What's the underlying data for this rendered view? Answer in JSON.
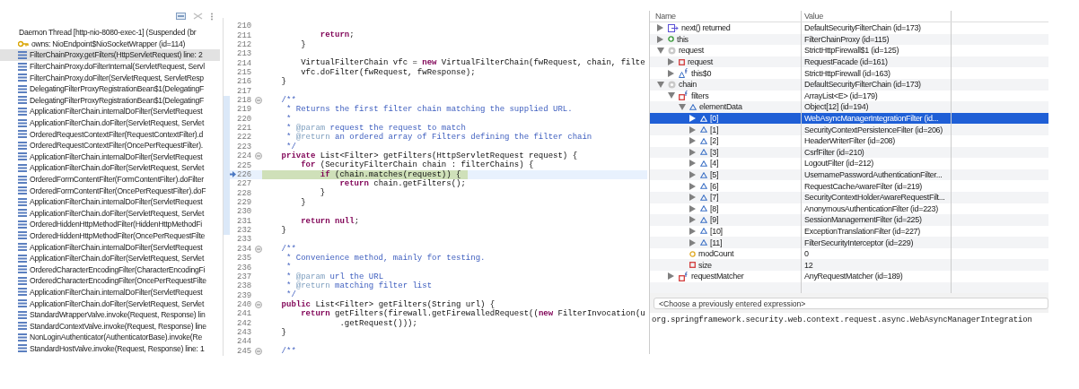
{
  "debug": {
    "thread": "Daemon Thread [http-nio-8080-exec-1] (Suspended (br",
    "monitor": "owns: NioEndpoint$NioSocketWrapper  (id=114)",
    "frames": [
      {
        "label": "FilterChainProxy.getFilters(HttpServletRequest) line: 2",
        "selected": true
      },
      {
        "label": "FilterChainProxy.doFilterInternal(ServletRequest, Servl",
        "selected": false
      },
      {
        "label": "FilterChainProxy.doFilter(ServletRequest, ServletResp",
        "selected": false
      },
      {
        "label": "DelegatingFilterProxyRegistrationBean$1(DelegatingF",
        "selected": false
      },
      {
        "label": "DelegatingFilterProxyRegistrationBean$1(DelegatingF",
        "selected": false
      },
      {
        "label": "ApplicationFilterChain.internalDoFilter(ServletRequest",
        "selected": false
      },
      {
        "label": "ApplicationFilterChain.doFilter(ServletRequest, Servlet",
        "selected": false
      },
      {
        "label": "OrderedRequestContextFilter(RequestContextFilter).d",
        "selected": false
      },
      {
        "label": "OrderedRequestContextFilter(OncePerRequestFilter).",
        "selected": false
      },
      {
        "label": "ApplicationFilterChain.internalDoFilter(ServletRequest",
        "selected": false
      },
      {
        "label": "ApplicationFilterChain.doFilter(ServletRequest, Servlet",
        "selected": false
      },
      {
        "label": "OrderedFormContentFilter(FormContentFilter).doFilter",
        "selected": false
      },
      {
        "label": "OrderedFormContentFilter(OncePerRequestFilter).doF",
        "selected": false
      },
      {
        "label": "ApplicationFilterChain.internalDoFilter(ServletRequest",
        "selected": false
      },
      {
        "label": "ApplicationFilterChain.doFilter(ServletRequest, Servlet",
        "selected": false
      },
      {
        "label": "OrderedHiddenHttpMethodFilter(HiddenHttpMethodFi",
        "selected": false
      },
      {
        "label": "OrderedHiddenHttpMethodFilter(OncePerRequestFilte",
        "selected": false
      },
      {
        "label": "ApplicationFilterChain.internalDoFilter(ServletRequest",
        "selected": false
      },
      {
        "label": "ApplicationFilterChain.doFilter(ServletRequest, Servlet",
        "selected": false
      },
      {
        "label": "OrderedCharacterEncodingFilter(CharacterEncodingFi",
        "selected": false
      },
      {
        "label": "OrderedCharacterEncodingFilter(OncePerRequestFilte",
        "selected": false
      },
      {
        "label": "ApplicationFilterChain.internalDoFilter(ServletRequest",
        "selected": false
      },
      {
        "label": "ApplicationFilterChain.doFilter(ServletRequest, Servlet",
        "selected": false
      },
      {
        "label": "StandardWrapperValve.invoke(Request, Response) lin",
        "selected": false
      },
      {
        "label": "StandardContextValve.invoke(Request, Response) line",
        "selected": false
      },
      {
        "label": "NonLoginAuthenticator(AuthenticatorBase).invoke(Re",
        "selected": false
      },
      {
        "label": "StandardHostValve.invoke(Request, Response) line: 1",
        "selected": false
      }
    ]
  },
  "editor": {
    "lines": [
      {
        "number": "210",
        "fold": false,
        "current": false,
        "marked": false
      },
      {
        "number": "211",
        "fold": false,
        "current": false,
        "marked": false,
        "segments": [
          {
            "kind": "keyword",
            "text": "            return"
          },
          {
            "kind": "code",
            "text": ";"
          }
        ]
      },
      {
        "number": "212",
        "fold": false,
        "current": false,
        "marked": false,
        "segments": [
          {
            "kind": "code",
            "text": "        }"
          }
        ]
      },
      {
        "number": "213",
        "fold": false,
        "current": false,
        "marked": false
      },
      {
        "number": "214",
        "fold": false,
        "current": false,
        "marked": false,
        "segments": [
          {
            "kind": "code",
            "text": "        VirtualFilterChain vfc = "
          },
          {
            "kind": "keyword",
            "text": "new"
          },
          {
            "kind": "code",
            "text": " VirtualFilterChain(fwRequest, chain, filte"
          }
        ]
      },
      {
        "number": "215",
        "fold": false,
        "current": false,
        "marked": false,
        "segments": [
          {
            "kind": "code",
            "text": "        vfc.doFilter(fwRequest, fwResponse);"
          }
        ]
      },
      {
        "number": "216",
        "fold": false,
        "current": false,
        "marked": false,
        "segments": [
          {
            "kind": "code",
            "text": "    }"
          }
        ]
      },
      {
        "number": "217",
        "fold": false,
        "current": false,
        "marked": false
      },
      {
        "number": "218",
        "fold": true,
        "current": false,
        "marked": true,
        "segments": [
          {
            "kind": "comment",
            "text": "    /**"
          }
        ]
      },
      {
        "number": "219",
        "fold": false,
        "current": false,
        "marked": true,
        "segments": [
          {
            "kind": "comment",
            "text": "     * Returns the first filter chain matching the supplied URL."
          }
        ]
      },
      {
        "number": "220",
        "fold": false,
        "current": false,
        "marked": true,
        "segments": [
          {
            "kind": "comment",
            "text": "     *"
          }
        ]
      },
      {
        "number": "221",
        "fold": false,
        "current": false,
        "marked": true,
        "segments": [
          {
            "kind": "comment",
            "text": "     * "
          },
          {
            "kind": "tag",
            "text": "@param"
          },
          {
            "kind": "comment",
            "text": " request the request to match"
          }
        ]
      },
      {
        "number": "222",
        "fold": false,
        "current": false,
        "marked": true,
        "segments": [
          {
            "kind": "comment",
            "text": "     * "
          },
          {
            "kind": "tag",
            "text": "@return"
          },
          {
            "kind": "comment",
            "text": " an ordered array of Filters defining the filter chain"
          }
        ]
      },
      {
        "number": "223",
        "fold": false,
        "current": false,
        "marked": true,
        "segments": [
          {
            "kind": "comment",
            "text": "     */"
          }
        ]
      },
      {
        "number": "224",
        "fold": true,
        "current": false,
        "marked": true,
        "segments": [
          {
            "kind": "keyword",
            "text": "    private"
          },
          {
            "kind": "code",
            "text": " List<Filter> getFilters(HttpServletRequest request) {"
          }
        ]
      },
      {
        "number": "225",
        "fold": false,
        "current": false,
        "marked": true,
        "segments": [
          {
            "kind": "keyword",
            "text": "        for"
          },
          {
            "kind": "code",
            "text": " (SecurityFilterChain chain : filterChains) {"
          }
        ]
      },
      {
        "number": "226",
        "fold": false,
        "current": true,
        "marked": true,
        "segments": [
          {
            "kind": "keyword",
            "text": "            if"
          },
          {
            "kind": "code",
            "text": " (chain.matches(request)) {"
          }
        ]
      },
      {
        "number": "227",
        "fold": false,
        "current": false,
        "marked": true,
        "segments": [
          {
            "kind": "keyword",
            "text": "                return"
          },
          {
            "kind": "code",
            "text": " chain.getFilters();"
          }
        ]
      },
      {
        "number": "228",
        "fold": false,
        "current": false,
        "marked": true,
        "segments": [
          {
            "kind": "code",
            "text": "            }"
          }
        ]
      },
      {
        "number": "229",
        "fold": false,
        "current": false,
        "marked": true,
        "segments": [
          {
            "kind": "code",
            "text": "        }"
          }
        ]
      },
      {
        "number": "230",
        "fold": false,
        "current": false,
        "marked": true
      },
      {
        "number": "231",
        "fold": false,
        "current": false,
        "marked": true,
        "segments": [
          {
            "kind": "keyword",
            "text": "        return null"
          },
          {
            "kind": "code",
            "text": ";"
          }
        ]
      },
      {
        "number": "232",
        "fold": false,
        "current": false,
        "marked": true,
        "segments": [
          {
            "kind": "code",
            "text": "    }"
          }
        ]
      },
      {
        "number": "233",
        "fold": false,
        "current": false,
        "marked": false
      },
      {
        "number": "234",
        "fold": true,
        "current": false,
        "marked": false,
        "segments": [
          {
            "kind": "comment",
            "text": "    /**"
          }
        ]
      },
      {
        "number": "235",
        "fold": false,
        "current": false,
        "marked": false,
        "segments": [
          {
            "kind": "comment",
            "text": "     * Convenience method, mainly for testing."
          }
        ]
      },
      {
        "number": "236",
        "fold": false,
        "current": false,
        "marked": false,
        "segments": [
          {
            "kind": "comment",
            "text": "     *"
          }
        ]
      },
      {
        "number": "237",
        "fold": false,
        "current": false,
        "marked": false,
        "segments": [
          {
            "kind": "comment",
            "text": "     * "
          },
          {
            "kind": "tag",
            "text": "@param"
          },
          {
            "kind": "comment",
            "text": " url the URL"
          }
        ]
      },
      {
        "number": "238",
        "fold": false,
        "current": false,
        "marked": false,
        "segments": [
          {
            "kind": "comment",
            "text": "     * "
          },
          {
            "kind": "tag",
            "text": "@return"
          },
          {
            "kind": "comment",
            "text": " matching filter list"
          }
        ]
      },
      {
        "number": "239",
        "fold": false,
        "current": false,
        "marked": false,
        "segments": [
          {
            "kind": "comment",
            "text": "     */"
          }
        ]
      },
      {
        "number": "240",
        "fold": true,
        "current": false,
        "marked": false,
        "segments": [
          {
            "kind": "keyword",
            "text": "    public"
          },
          {
            "kind": "code",
            "text": " List<Filter> getFilters(String url) {"
          }
        ]
      },
      {
        "number": "241",
        "fold": false,
        "current": false,
        "marked": false,
        "segments": [
          {
            "kind": "keyword",
            "text": "        return"
          },
          {
            "kind": "code",
            "text": " getFilters(firewall.getFirewalledRequest(("
          },
          {
            "kind": "keyword",
            "text": "new"
          },
          {
            "kind": "code",
            "text": " FilterInvocation(u"
          }
        ]
      },
      {
        "number": "242",
        "fold": false,
        "current": false,
        "marked": false,
        "segments": [
          {
            "kind": "code",
            "text": "                .getRequest()));"
          }
        ]
      },
      {
        "number": "243",
        "fold": false,
        "current": false,
        "marked": false,
        "segments": [
          {
            "kind": "code",
            "text": "    }"
          }
        ]
      },
      {
        "number": "244",
        "fold": false,
        "current": false,
        "marked": false
      },
      {
        "number": "245",
        "fold": true,
        "current": false,
        "marked": false,
        "segments": [
          {
            "kind": "comment",
            "text": "    /**"
          }
        ]
      }
    ]
  },
  "variables": {
    "columns": [
      "Name",
      "Value"
    ],
    "rows": [
      {
        "name": "next() returned",
        "value": "DefaultSecurityFilterChain  (id=173)",
        "kind": "return",
        "expandable": true,
        "expanded": false,
        "selected": false
      },
      {
        "name": "this",
        "value": "FilterChainProxy  (id=115)",
        "kind": "local",
        "expandable": true,
        "expanded": false,
        "selected": false
      },
      {
        "name": "request",
        "value": "StrictHttpFirewall$1  (id=125)",
        "kind": "param",
        "expandable": true,
        "expanded": true,
        "selected": false,
        "children": [
          {
            "name": "request",
            "value": "RequestFacade  (id=161)",
            "kind": "private",
            "expandable": true,
            "expanded": false,
            "selected": false
          },
          {
            "name": "this$0",
            "value": "StrictHttpFirewall  (id=163)",
            "kind": "final",
            "expandable": true,
            "expanded": false,
            "selected": false
          }
        ]
      },
      {
        "name": "chain",
        "value": "DefaultSecurityFilterChain  (id=173)",
        "kind": "param",
        "expandable": true,
        "expanded": true,
        "selected": false,
        "children": [
          {
            "name": "filters",
            "value": "ArrayList<E>  (id=179)",
            "kind": "private-final",
            "expandable": true,
            "expanded": true,
            "selected": false,
            "children": [
              {
                "name": "elementData",
                "value": "Object[12]  (id=194)",
                "kind": "package",
                "expandable": true,
                "expanded": true,
                "selected": false,
                "children": [
                  {
                    "name": "[0]",
                    "value": "WebAsyncManagerIntegrationFilter  (id...",
                    "kind": "package",
                    "expandable": true,
                    "expanded": false,
                    "selected": true
                  },
                  {
                    "name": "[1]",
                    "value": "SecurityContextPersistenceFilter  (id=206)",
                    "kind": "package",
                    "expandable": true,
                    "expanded": false,
                    "selected": false
                  },
                  {
                    "name": "[2]",
                    "value": "HeaderWriterFilter  (id=208)",
                    "kind": "package",
                    "expandable": true,
                    "expanded": false,
                    "selected": false
                  },
                  {
                    "name": "[3]",
                    "value": "CsrfFilter  (id=210)",
                    "kind": "package",
                    "expandable": true,
                    "expanded": false,
                    "selected": false
                  },
                  {
                    "name": "[4]",
                    "value": "LogoutFilter  (id=212)",
                    "kind": "package",
                    "expandable": true,
                    "expanded": false,
                    "selected": false
                  },
                  {
                    "name": "[5]",
                    "value": "UsernamePasswordAuthenticationFilter...",
                    "kind": "package",
                    "expandable": true,
                    "expanded": false,
                    "selected": false
                  },
                  {
                    "name": "[6]",
                    "value": "RequestCacheAwareFilter  (id=219)",
                    "kind": "package",
                    "expandable": true,
                    "expanded": false,
                    "selected": false
                  },
                  {
                    "name": "[7]",
                    "value": "SecurityContextHolderAwareRequestFilt...",
                    "kind": "package",
                    "expandable": true,
                    "expanded": false,
                    "selected": false
                  },
                  {
                    "name": "[8]",
                    "value": "AnonymousAuthenticationFilter  (id=223)",
                    "kind": "package",
                    "expandable": true,
                    "expanded": false,
                    "selected": false
                  },
                  {
                    "name": "[9]",
                    "value": "SessionManagementFilter  (id=225)",
                    "kind": "package",
                    "expandable": true,
                    "expanded": false,
                    "selected": false
                  },
                  {
                    "name": "[10]",
                    "value": "ExceptionTranslationFilter  (id=227)",
                    "kind": "package",
                    "expandable": true,
                    "expanded": false,
                    "selected": false
                  },
                  {
                    "name": "[11]",
                    "value": "FilterSecurityInterceptor  (id=229)",
                    "kind": "package",
                    "expandable": true,
                    "expanded": false,
                    "selected": false
                  }
                ]
              },
              {
                "name": "modCount",
                "value": "0",
                "kind": "protected",
                "expandable": false,
                "selected": false
              },
              {
                "name": "size",
                "value": "12",
                "kind": "private",
                "expandable": false,
                "selected": false
              }
            ]
          },
          {
            "name": "requestMatcher",
            "value": "AnyRequestMatcher  (id=189)",
            "kind": "private-final",
            "expandable": true,
            "expanded": false,
            "selected": false
          }
        ]
      }
    ],
    "expression": {
      "placeholder": "<Choose a previously entered expression>"
    },
    "detail": "org.springframework.security.web.context.request.async.WebAsyncManagerIntegration"
  }
}
